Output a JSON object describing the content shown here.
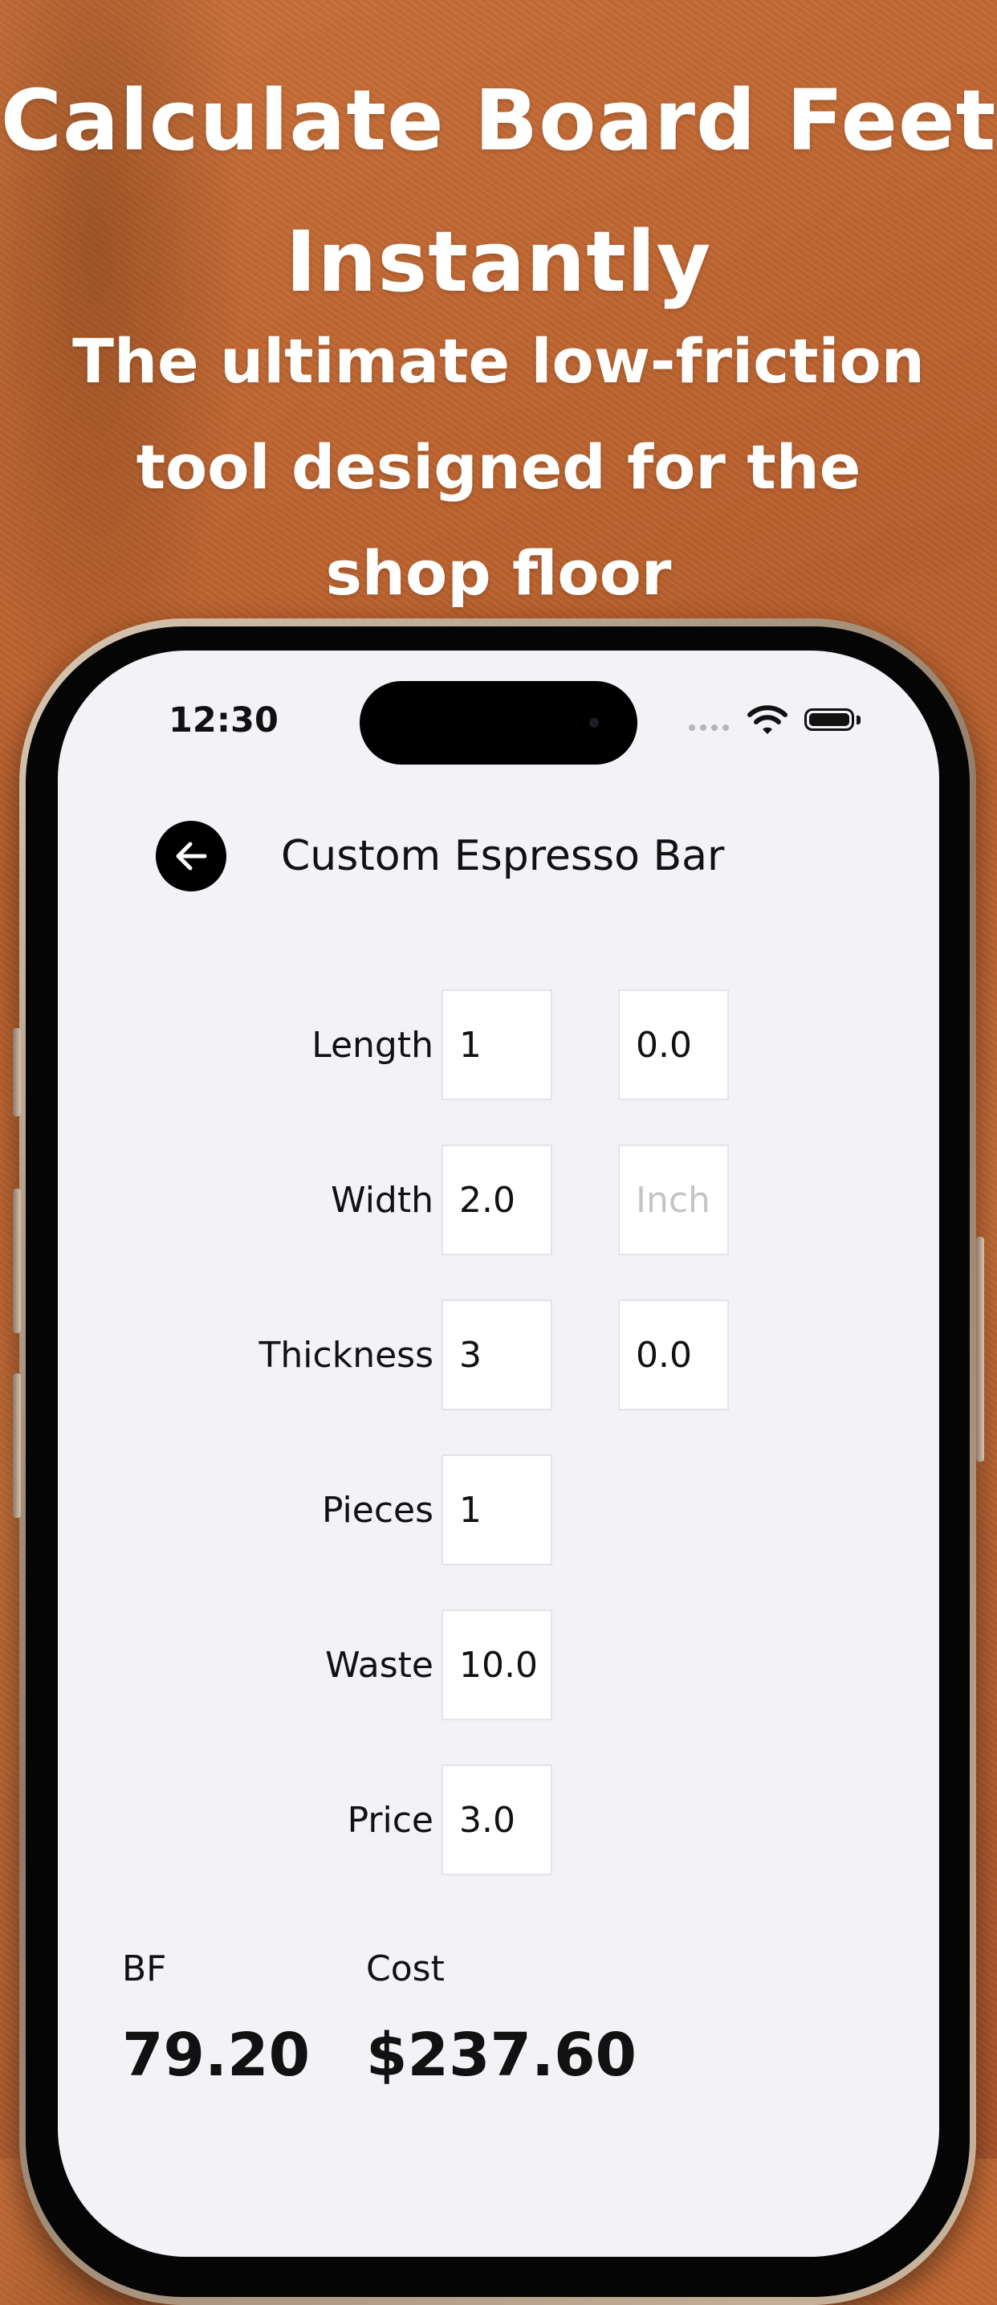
{
  "promo": {
    "headline": "Calculate Board Feet Instantly",
    "subheadline": "The ultimate low-friction tool designed for the shop floor"
  },
  "status_bar": {
    "time": "12:30",
    "icons": [
      "signal-icon",
      "wifi-icon",
      "battery-icon"
    ]
  },
  "nav": {
    "back_icon": "arrow-left-icon",
    "title": "Custom Espresso Bar"
  },
  "form": {
    "length": {
      "label": "Length",
      "value": "1",
      "secondary_value": "0.0"
    },
    "width": {
      "label": "Width",
      "value": "2.0",
      "secondary_placeholder": "Inch"
    },
    "thickness": {
      "label": "Thickness",
      "value": "3",
      "secondary_value": "0.0"
    },
    "pieces": {
      "label": "Pieces",
      "value": "1"
    },
    "waste": {
      "label": "Waste",
      "value": "10.0"
    },
    "price": {
      "label": "Price",
      "value": "3.0"
    }
  },
  "results": {
    "bf_label": "BF",
    "bf_value": "79.20",
    "cost_label": "Cost",
    "cost_value": "$237.60"
  },
  "colors": {
    "background": "#b85f2c",
    "screen": "#f2f2f7",
    "text": "#111111",
    "placeholder": "#c4c4c8"
  }
}
